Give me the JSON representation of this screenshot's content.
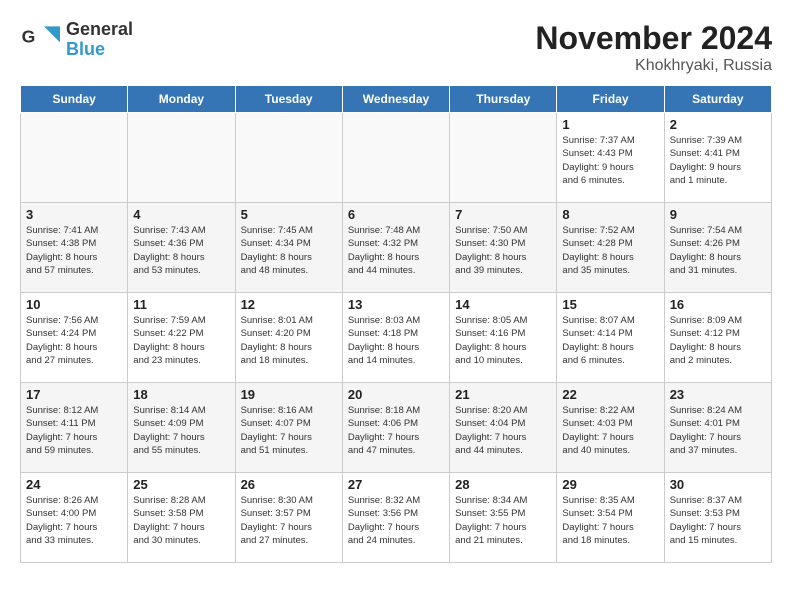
{
  "header": {
    "logo_general": "General",
    "logo_blue": "Blue",
    "month_title": "November 2024",
    "subtitle": "Khokhryaki, Russia"
  },
  "days_of_week": [
    "Sunday",
    "Monday",
    "Tuesday",
    "Wednesday",
    "Thursday",
    "Friday",
    "Saturday"
  ],
  "weeks": [
    [
      {
        "day": "",
        "info": ""
      },
      {
        "day": "",
        "info": ""
      },
      {
        "day": "",
        "info": ""
      },
      {
        "day": "",
        "info": ""
      },
      {
        "day": "",
        "info": ""
      },
      {
        "day": "1",
        "info": "Sunrise: 7:37 AM\nSunset: 4:43 PM\nDaylight: 9 hours\nand 6 minutes."
      },
      {
        "day": "2",
        "info": "Sunrise: 7:39 AM\nSunset: 4:41 PM\nDaylight: 9 hours\nand 1 minute."
      }
    ],
    [
      {
        "day": "3",
        "info": "Sunrise: 7:41 AM\nSunset: 4:38 PM\nDaylight: 8 hours\nand 57 minutes."
      },
      {
        "day": "4",
        "info": "Sunrise: 7:43 AM\nSunset: 4:36 PM\nDaylight: 8 hours\nand 53 minutes."
      },
      {
        "day": "5",
        "info": "Sunrise: 7:45 AM\nSunset: 4:34 PM\nDaylight: 8 hours\nand 48 minutes."
      },
      {
        "day": "6",
        "info": "Sunrise: 7:48 AM\nSunset: 4:32 PM\nDaylight: 8 hours\nand 44 minutes."
      },
      {
        "day": "7",
        "info": "Sunrise: 7:50 AM\nSunset: 4:30 PM\nDaylight: 8 hours\nand 39 minutes."
      },
      {
        "day": "8",
        "info": "Sunrise: 7:52 AM\nSunset: 4:28 PM\nDaylight: 8 hours\nand 35 minutes."
      },
      {
        "day": "9",
        "info": "Sunrise: 7:54 AM\nSunset: 4:26 PM\nDaylight: 8 hours\nand 31 minutes."
      }
    ],
    [
      {
        "day": "10",
        "info": "Sunrise: 7:56 AM\nSunset: 4:24 PM\nDaylight: 8 hours\nand 27 minutes."
      },
      {
        "day": "11",
        "info": "Sunrise: 7:59 AM\nSunset: 4:22 PM\nDaylight: 8 hours\nand 23 minutes."
      },
      {
        "day": "12",
        "info": "Sunrise: 8:01 AM\nSunset: 4:20 PM\nDaylight: 8 hours\nand 18 minutes."
      },
      {
        "day": "13",
        "info": "Sunrise: 8:03 AM\nSunset: 4:18 PM\nDaylight: 8 hours\nand 14 minutes."
      },
      {
        "day": "14",
        "info": "Sunrise: 8:05 AM\nSunset: 4:16 PM\nDaylight: 8 hours\nand 10 minutes."
      },
      {
        "day": "15",
        "info": "Sunrise: 8:07 AM\nSunset: 4:14 PM\nDaylight: 8 hours\nand 6 minutes."
      },
      {
        "day": "16",
        "info": "Sunrise: 8:09 AM\nSunset: 4:12 PM\nDaylight: 8 hours\nand 2 minutes."
      }
    ],
    [
      {
        "day": "17",
        "info": "Sunrise: 8:12 AM\nSunset: 4:11 PM\nDaylight: 7 hours\nand 59 minutes."
      },
      {
        "day": "18",
        "info": "Sunrise: 8:14 AM\nSunset: 4:09 PM\nDaylight: 7 hours\nand 55 minutes."
      },
      {
        "day": "19",
        "info": "Sunrise: 8:16 AM\nSunset: 4:07 PM\nDaylight: 7 hours\nand 51 minutes."
      },
      {
        "day": "20",
        "info": "Sunrise: 8:18 AM\nSunset: 4:06 PM\nDaylight: 7 hours\nand 47 minutes."
      },
      {
        "day": "21",
        "info": "Sunrise: 8:20 AM\nSunset: 4:04 PM\nDaylight: 7 hours\nand 44 minutes."
      },
      {
        "day": "22",
        "info": "Sunrise: 8:22 AM\nSunset: 4:03 PM\nDaylight: 7 hours\nand 40 minutes."
      },
      {
        "day": "23",
        "info": "Sunrise: 8:24 AM\nSunset: 4:01 PM\nDaylight: 7 hours\nand 37 minutes."
      }
    ],
    [
      {
        "day": "24",
        "info": "Sunrise: 8:26 AM\nSunset: 4:00 PM\nDaylight: 7 hours\nand 33 minutes."
      },
      {
        "day": "25",
        "info": "Sunrise: 8:28 AM\nSunset: 3:58 PM\nDaylight: 7 hours\nand 30 minutes."
      },
      {
        "day": "26",
        "info": "Sunrise: 8:30 AM\nSunset: 3:57 PM\nDaylight: 7 hours\nand 27 minutes."
      },
      {
        "day": "27",
        "info": "Sunrise: 8:32 AM\nSunset: 3:56 PM\nDaylight: 7 hours\nand 24 minutes."
      },
      {
        "day": "28",
        "info": "Sunrise: 8:34 AM\nSunset: 3:55 PM\nDaylight: 7 hours\nand 21 minutes."
      },
      {
        "day": "29",
        "info": "Sunrise: 8:35 AM\nSunset: 3:54 PM\nDaylight: 7 hours\nand 18 minutes."
      },
      {
        "day": "30",
        "info": "Sunrise: 8:37 AM\nSunset: 3:53 PM\nDaylight: 7 hours\nand 15 minutes."
      }
    ]
  ]
}
